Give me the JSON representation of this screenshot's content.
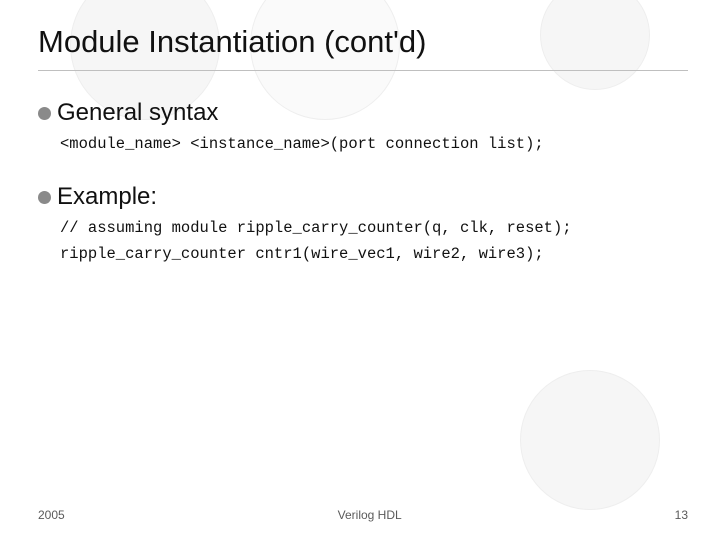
{
  "title": "Module Instantiation (cont'd)",
  "sections": [
    {
      "heading": "General syntax",
      "code": [
        "<module_name> <instance_name>(port connection list);"
      ]
    },
    {
      "heading": "Example:",
      "code": [
        "// assuming module ripple_carry_counter(q, clk, reset);",
        "ripple_carry_counter cntr1(wire_vec1, wire2, wire3);"
      ]
    }
  ],
  "footer": {
    "year": "2005",
    "center": "Verilog HDL",
    "page": "13"
  }
}
